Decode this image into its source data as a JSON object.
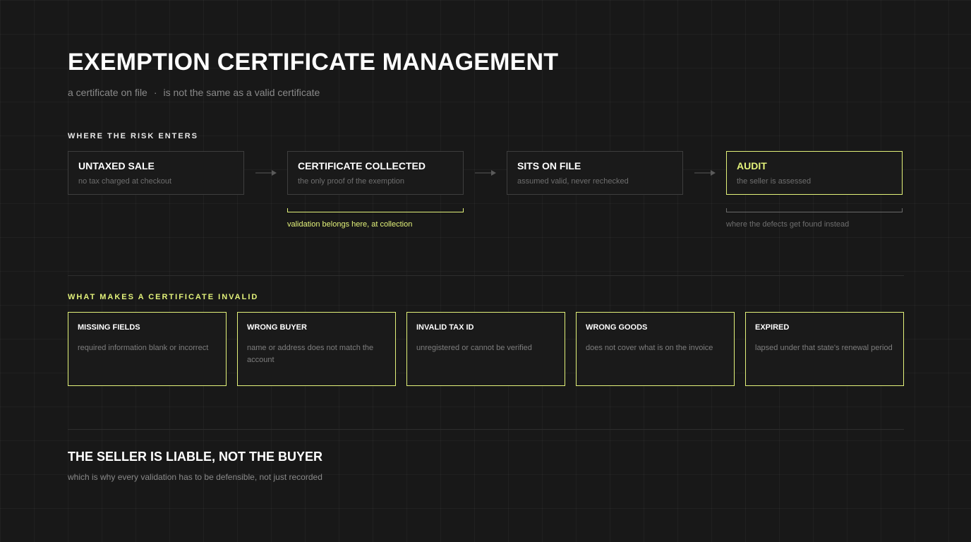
{
  "header": {
    "title": "EXEMPTION CERTIFICATE MANAGEMENT",
    "subtitle_left": "a certificate on file",
    "subtitle_sep": "·",
    "subtitle_right": "is not the same as a valid certificate"
  },
  "risk": {
    "label": "WHERE THE RISK ENTERS",
    "steps": [
      {
        "title": "UNTAXED SALE",
        "desc": "no tax charged at checkout"
      },
      {
        "title": "CERTIFICATE COLLECTED",
        "desc": "the only proof of the exemption"
      },
      {
        "title": "SITS ON FILE",
        "desc": "assumed valid, never rechecked"
      },
      {
        "title": "AUDIT",
        "desc": "the seller is assessed"
      }
    ],
    "notes": {
      "collection": "validation belongs here, at collection",
      "audit": "where the defects get found instead"
    }
  },
  "invalid": {
    "label": "WHAT MAKES A CERTIFICATE INVALID",
    "cards": [
      {
        "title": "MISSING FIELDS",
        "desc": "required information blank or incorrect"
      },
      {
        "title": "WRONG BUYER",
        "desc": "name or address does not match the account"
      },
      {
        "title": "INVALID TAX ID",
        "desc": "unregistered or cannot be verified"
      },
      {
        "title": "WRONG GOODS",
        "desc": "does not cover what is on the invoice"
      },
      {
        "title": "EXPIRED",
        "desc": "lapsed under that state's renewal period"
      }
    ]
  },
  "footer": {
    "title": "THE SELLER IS LIABLE, NOT THE BUYER",
    "subtitle": "which is why every validation has to be defensible, not just recorded"
  },
  "colors": {
    "background": "#181818",
    "accent": "#e3f27a",
    "box_border": "#3e3e3e",
    "muted_text": "#8a8a8a"
  }
}
